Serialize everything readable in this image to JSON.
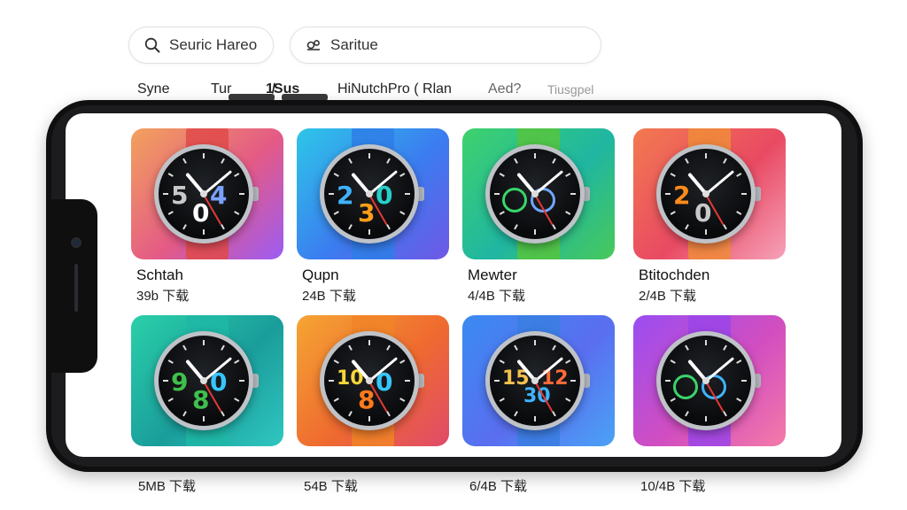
{
  "search": {
    "left_text": "Seuric Hareo",
    "right_text": "Saritue"
  },
  "tabs": [
    "Syne",
    "Tur",
    "1̸Sus",
    "HiNutchPro ( Rlan",
    "Aed?",
    "Tiusgpel"
  ],
  "cards": [
    {
      "name": "Schtah",
      "meta": "39b 下载",
      "gradient": [
        "#f2a25c",
        "#e45a86",
        "#9b5cf5"
      ],
      "strap": "#e04a4a",
      "digits": [
        "5",
        "0",
        "4"
      ],
      "digit_colors": [
        "#c9c9c9",
        "#ffffff",
        "#7aa3ff"
      ]
    },
    {
      "name": "Qupn",
      "meta": "24B 下载",
      "gradient": [
        "#2dc6e8",
        "#3b7cf0",
        "#6f58e6"
      ],
      "strap": "#2f7ee8",
      "digits": [
        "2",
        "3",
        "0"
      ],
      "digit_colors": [
        "#3fb3ff",
        "#ff9f1a",
        "#25d0c9"
      ]
    },
    {
      "name": "Mewter",
      "meta": "4/4B 下载",
      "gradient": [
        "#3fd26c",
        "#1fb6a2",
        "#48c95a"
      ],
      "strap": "#56c43e",
      "digits": [
        "",
        "",
        ""
      ],
      "digit_colors": [
        "#3ad46b",
        "#6fa7ff",
        "#3ad46b"
      ]
    },
    {
      "name": "Btitochden",
      "meta": "2/4B 下载",
      "gradient": [
        "#f27a4f",
        "#e94a63",
        "#f6a2ba"
      ],
      "strap": "#f08b3a",
      "digits": [
        "2",
        "0",
        ""
      ],
      "digit_colors": [
        "#ff8c1a",
        "#c9c9c9",
        "#ffffff"
      ]
    },
    {
      "name": "",
      "meta": "5MB 下载",
      "gradient": [
        "#2ad0a9",
        "#1a9d9b",
        "#30c7c0"
      ],
      "strap": "#1fb7a6",
      "digits": [
        "9",
        "8",
        "0"
      ],
      "digit_colors": [
        "#3fbf4b",
        "#3fbf4b",
        "#36c6ff"
      ]
    },
    {
      "name": "",
      "meta": "54B 下载",
      "gradient": [
        "#f5a533",
        "#ef6a2f",
        "#e04a6a"
      ],
      "strap": "#f18427",
      "digits": [
        "10",
        "8",
        "0"
      ],
      "digit_colors": [
        "#f7d63a",
        "#ff7a1a",
        "#36c6ff"
      ]
    },
    {
      "name": "",
      "meta": "6/4B 下载",
      "gradient": [
        "#3a8bf2",
        "#5a6ef0",
        "#4aa2f5"
      ],
      "strap": "#3a7ee2",
      "digits": [
        "15",
        "30",
        "12"
      ],
      "digit_colors": [
        "#f2c14e",
        "#3fb3ff",
        "#ff6a3a"
      ]
    },
    {
      "name": "",
      "meta": "10/4B 下载",
      "gradient": [
        "#9a4df2",
        "#d24ec0",
        "#f47aa8"
      ],
      "strap": "#9b45e8",
      "digits": [
        "",
        "",
        ""
      ],
      "digit_colors": [
        "#3ad46b",
        "#3fb3ff",
        "#3ad46b"
      ]
    }
  ]
}
